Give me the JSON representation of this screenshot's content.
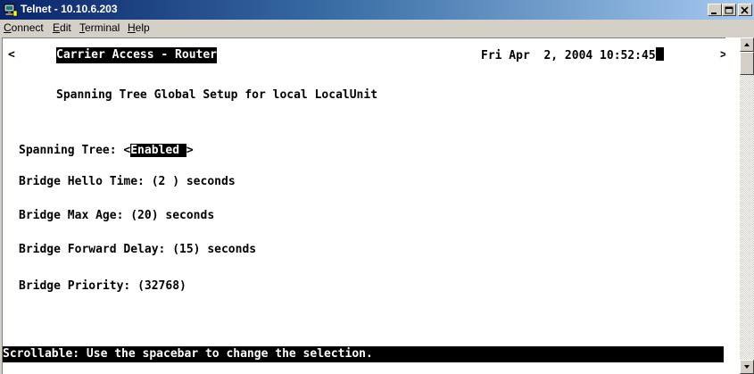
{
  "window": {
    "title": "Telnet - 10.10.6.203",
    "icon": "telnet-app-icon",
    "controls": [
      "minimize-icon",
      "maximize-icon",
      "close-icon"
    ]
  },
  "menu": {
    "items": [
      {
        "label_first": "C",
        "label_rest": "onnect"
      },
      {
        "label_first": "E",
        "label_rest": "dit"
      },
      {
        "label_first": "T",
        "label_rest": "erminal"
      },
      {
        "label_first": "H",
        "label_rest": "elp"
      }
    ]
  },
  "terminal": {
    "left_marker": "<",
    "right_marker": ">",
    "header_title": "Carrier Access - Router",
    "datetime": "Fri Apr  2, 2004 10:52:45",
    "screen_title": "Spanning Tree Global Setup for local LocalUnit",
    "spanning_tree": {
      "label": "Spanning Tree: ",
      "open": "<",
      "value": "Enabled ",
      "close": ">"
    },
    "hello_time": {
      "label": "Bridge Hello Time: ",
      "value": "(2 )",
      "unit": " seconds"
    },
    "max_age": {
      "label": "Bridge Max Age: ",
      "value": "(20)",
      "unit": " seconds"
    },
    "forward_delay": {
      "label": "Bridge Forward Delay: ",
      "value": "(15)",
      "unit": " seconds"
    },
    "priority": {
      "label": "Bridge Priority: ",
      "value": "(32768)"
    },
    "status": "Scrollable: Use the spacebar to change the selection."
  },
  "colors": {
    "terminal_bg": "#ffffff",
    "terminal_fg": "#000000",
    "titlebar_start": "#0a246a",
    "titlebar_end": "#a6caf0",
    "chrome": "#d4d0c8"
  }
}
